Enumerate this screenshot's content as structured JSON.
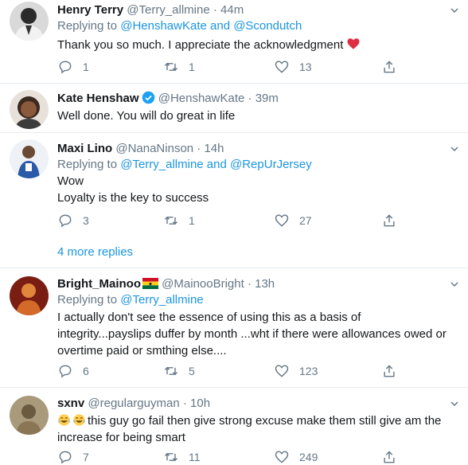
{
  "tweets": [
    {
      "name": "Henry Terry",
      "handle": "@Terry_allmine",
      "time": "44m",
      "replying_prefix": "Replying to",
      "replying_links": "@HenshawKate and @Scondutch",
      "body": "Thank you so much. I appreciate the acknowledgment",
      "replies": "1",
      "retweets": "1",
      "likes": "13"
    },
    {
      "name": "Kate Henshaw",
      "handle": "@HenshawKate",
      "time": "39m",
      "body": "Well done. You will do great in life"
    },
    {
      "name": "Maxi Lino",
      "handle": "@NanaNinson",
      "time": "14h",
      "replying_prefix": "Replying to",
      "replying_links": "@Terry_allmine and @RepUrJersey",
      "body_lines": [
        "Wow",
        "Loyalty is the key to success"
      ],
      "replies": "3",
      "retweets": "1",
      "likes": "27"
    },
    {
      "name": "Bright_Mainoo",
      "handle": "@MainooBright",
      "time": "13h",
      "replying_prefix": "Replying to",
      "replying_links": "@Terry_allmine",
      "body": "I actually don't see the essence of using this as a basis of integrity...payslips duffer by month ...wht if there were allowances owed or overtime paid or smthing else....",
      "replies": "6",
      "retweets": "5",
      "likes": "123"
    },
    {
      "name": "sxnv",
      "handle": "@regularguyman",
      "time": "10h",
      "body": "this guy go fail then give strong excuse make them still give am the increase for being smart",
      "replies": "7",
      "retweets": "11",
      "likes": "249"
    }
  ],
  "more_replies": "4 more replies",
  "dot": "·",
  "colors": {
    "link": "#1b95e0",
    "muted": "#657786",
    "divider": "#e6ecf0",
    "heart": "#e0245e"
  }
}
